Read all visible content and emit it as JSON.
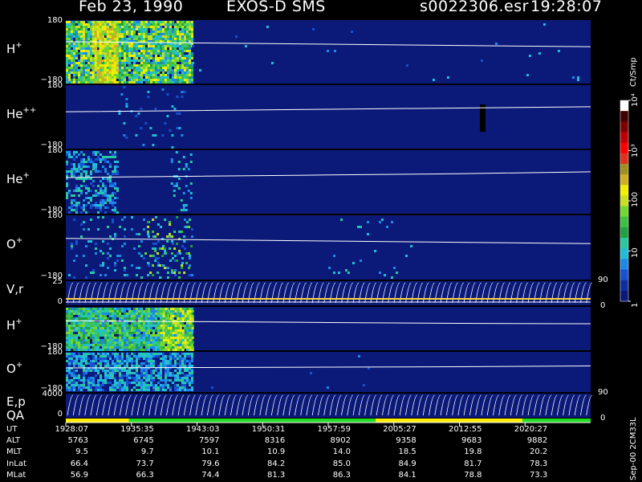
{
  "header": {
    "date": "Feb 23, 1990",
    "instrument": "EXOS-D SMS",
    "file": "s0022306.esr",
    "time": "19:28:07"
  },
  "colors": {
    "background": "#000000",
    "panel_fill": "#0b1a78",
    "track_line": "#ffffff",
    "quality_good": "#22dd22",
    "quality_flag": "#ffee00"
  },
  "chart_data": {
    "type": "heatmap",
    "title": "Feb 23, 1990   EXOS-D SMS",
    "panels": [
      {
        "label": "H",
        "sup": "+",
        "yrange": [
          -180,
          180
        ],
        "ytop": "180",
        "ybot": "−180",
        "track": [
          0.66,
          0.64,
          0.62,
          0.6,
          0.58
        ]
      },
      {
        "label": "He",
        "sup": "++",
        "yrange": [
          -180,
          180
        ],
        "ytop": "180",
        "ybot": "−180",
        "track": [
          0.58,
          0.6,
          0.62,
          0.64,
          0.66
        ]
      },
      {
        "label": "He",
        "sup": "+",
        "yrange": [
          -180,
          180
        ],
        "ytop": "180",
        "ybot": "−180",
        "track": [
          0.57,
          0.59,
          0.61,
          0.63,
          0.66
        ]
      },
      {
        "label": "O",
        "sup": "+",
        "yrange": [
          -180,
          180
        ],
        "ytop": "180",
        "ybot": "−180",
        "track": [
          0.64,
          0.62,
          0.6,
          0.58,
          0.56
        ]
      },
      {
        "label": "V,r",
        "sup": "",
        "yrange": [
          0,
          25
        ],
        "ytop": "25",
        "ybot": "0",
        "rtop": "90",
        "rbot": "0"
      },
      {
        "label": "H",
        "sup": "+",
        "yrange": [
          -180,
          180
        ],
        "ytop": "",
        "ybot": "−180",
        "track": [
          0.68,
          0.66,
          0.64,
          0.62,
          0.61
        ]
      },
      {
        "label": "O",
        "sup": "+",
        "yrange": [
          -180,
          180
        ],
        "ytop": "180",
        "ybot": "−180",
        "track": [
          0.6,
          0.61,
          0.62,
          0.63,
          0.65
        ]
      },
      {
        "label": "E,p",
        "sup": "",
        "yrange": [
          0,
          4000
        ],
        "ytop": "4000",
        "ybot": "0",
        "rtop": "90",
        "rbot": "0"
      }
    ],
    "qa_label": "QA",
    "qa_segments": [
      {
        "from": 0.0,
        "to": 0.12,
        "state": "flag"
      },
      {
        "from": 0.12,
        "to": 0.59,
        "state": "good"
      },
      {
        "from": 0.59,
        "to": 0.63,
        "state": "flag"
      },
      {
        "from": 0.63,
        "to": 0.87,
        "state": "flag"
      },
      {
        "from": 0.87,
        "to": 1.0,
        "state": "good"
      }
    ],
    "colorbar": {
      "unit": "Ct/Smp",
      "scale": "log",
      "range": [
        1,
        10000
      ],
      "tick_labels": [
        "1",
        "10",
        "100",
        "10³",
        "10⁴"
      ],
      "colors": [
        "#0b1a78",
        "#0d2fa0",
        "#1750d0",
        "#1e88e8",
        "#20bcd8",
        "#28c8a0",
        "#20a040",
        "#40c040",
        "#70d830",
        "#c8e020",
        "#f0f000",
        "#d0b020",
        "#a09020",
        "#e03020",
        "#ff0000",
        "#c00000",
        "#800000",
        "#400000",
        "#ffffff"
      ]
    },
    "time_axis": {
      "UT": [
        "1928:07",
        "1935:35",
        "1943:03",
        "1950:31",
        "1957:59",
        "2005:27",
        "2012:55",
        "2020:27"
      ],
      "ALT": [
        "5763",
        "6745",
        "7597",
        "8316",
        "8902",
        "9358",
        "9683",
        "9882"
      ],
      "MLT": [
        "9.5",
        "9.7",
        "10.1",
        "10.9",
        "14.0",
        "18.5",
        "19.8",
        "20.2"
      ],
      "InLat": [
        "66.4",
        "73.7",
        "79.6",
        "84.2",
        "85.0",
        "84.9",
        "81.7",
        "78.3"
      ],
      "MLat": [
        "56.9",
        "66.3",
        "74.4",
        "81.3",
        "86.3",
        "84.1",
        "78.8",
        "73.3"
      ]
    }
  },
  "footer": {
    "row_labels": [
      "UT",
      "ALT",
      "MLT",
      "InLat",
      "MLat"
    ],
    "version": "Sep-00 2CM33L"
  }
}
